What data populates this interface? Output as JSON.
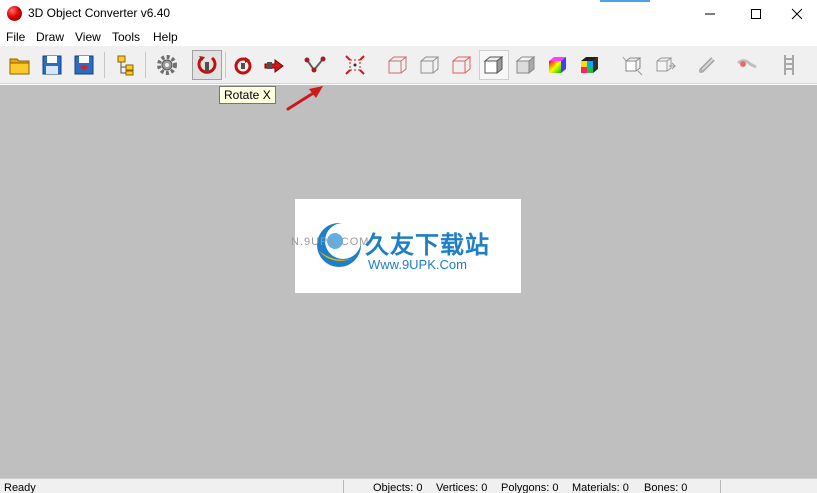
{
  "window": {
    "title": "3D Object Converter v6.40"
  },
  "menu": [
    "File",
    "Draw",
    "View",
    "Tools",
    "Help"
  ],
  "toolbar": {
    "tooltip": "Rotate X",
    "buttons": [
      {
        "name": "open-folder-icon"
      },
      {
        "name": "save-icon"
      },
      {
        "name": "save-special-icon"
      },
      {
        "name": "hierarchy-icon"
      },
      {
        "name": "settings-gear-icon"
      },
      {
        "name": "rotate-x-icon"
      },
      {
        "name": "rotate-y-icon"
      },
      {
        "name": "rotate-z-icon"
      },
      {
        "name": "move-vertex-icon"
      },
      {
        "name": "scale-icon"
      },
      {
        "name": "wireframe-box-icon"
      },
      {
        "name": "wireframe-box-2-icon"
      },
      {
        "name": "wireframe-box-red-icon"
      },
      {
        "name": "flat-shaded-box-icon"
      },
      {
        "name": "smooth-shaded-box-icon"
      },
      {
        "name": "colored-box-icon"
      },
      {
        "name": "textured-box-icon"
      },
      {
        "name": "explode-box-icon"
      },
      {
        "name": "box-arrow-icon"
      },
      {
        "name": "bone-tool-icon"
      },
      {
        "name": "skin-tool-icon"
      },
      {
        "name": "ladder-icon"
      }
    ]
  },
  "watermark": {
    "chinese": "久友下载站",
    "url": "Www.9UPK.Com",
    "side": "N.9UPK.COM"
  },
  "status": {
    "ready": "Ready",
    "objects": "Objects: 0",
    "vertices": "Vertices: 0",
    "polygons": "Polygons: 0",
    "materials": "Materials: 0",
    "bones": "Bones: 0"
  },
  "colors": {
    "canvas": "#bfbfbf",
    "toolbar": "#f0f0f0",
    "accent_arrow": "#e02020",
    "brand_blue": "#1e7fc6"
  }
}
